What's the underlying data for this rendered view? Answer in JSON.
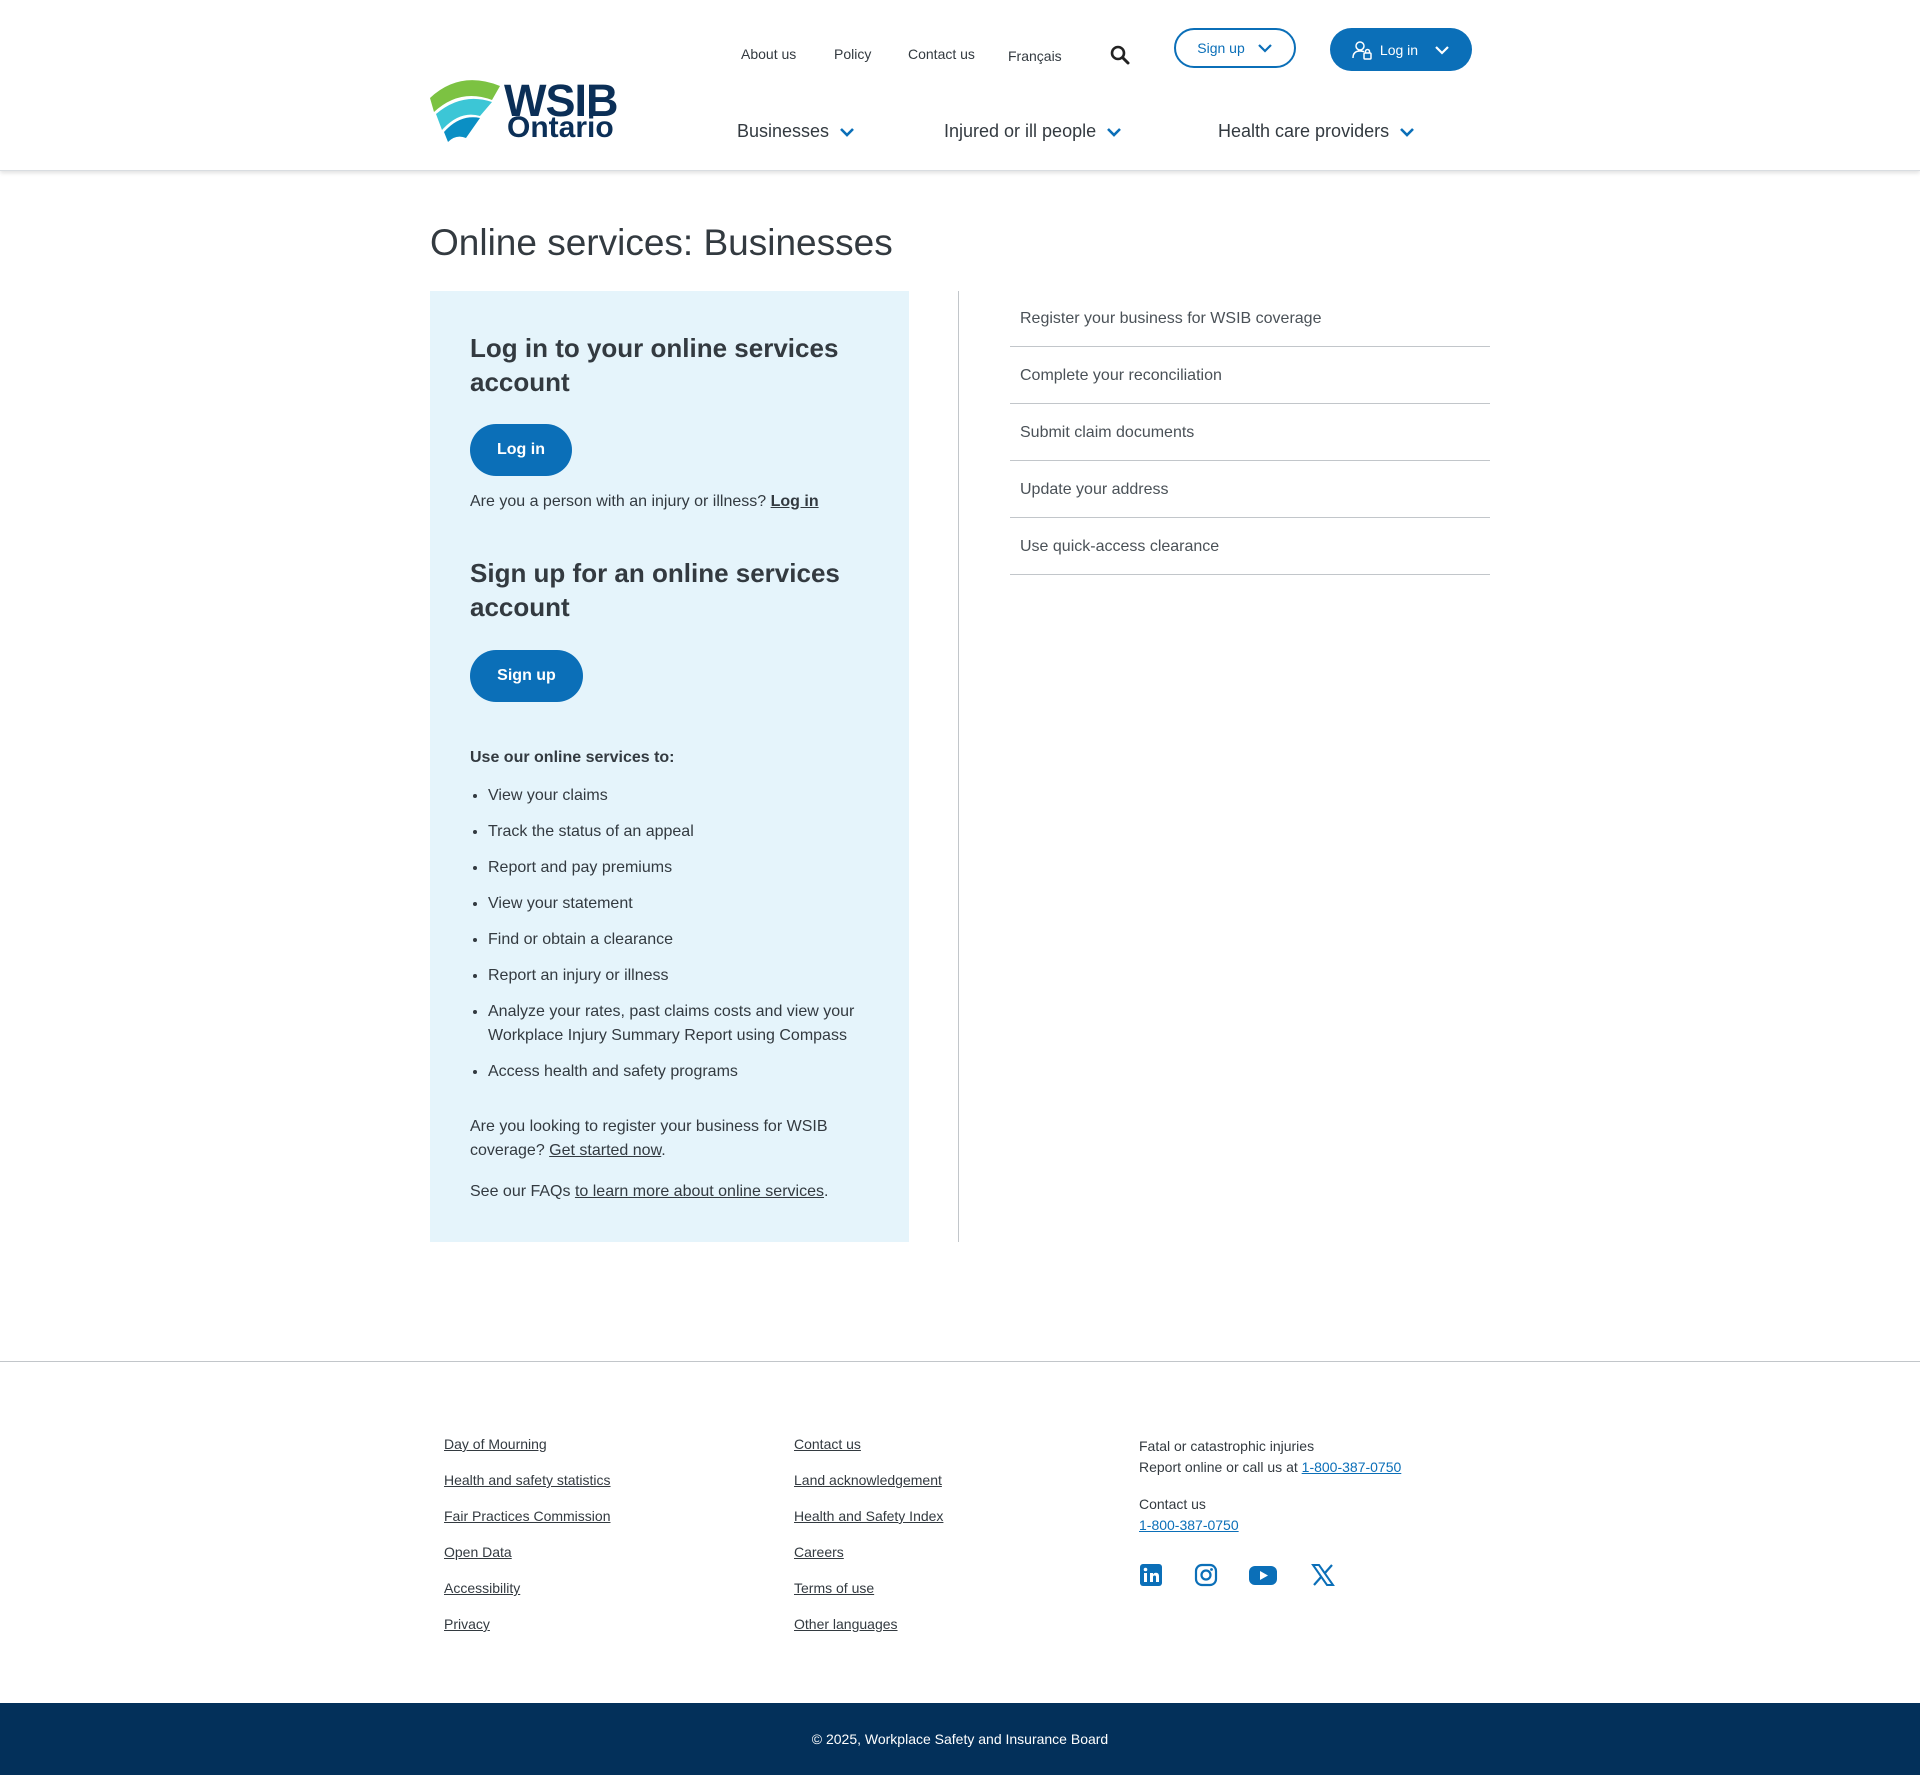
{
  "header": {
    "logo": {
      "line1": "WSIB",
      "line2": "Ontario"
    },
    "utility_nav": [
      "About us",
      "Policy",
      "Contact us",
      "Français"
    ],
    "signup_label": "Sign up",
    "login_label": "Log in",
    "main_nav": [
      "Businesses",
      "Injured or ill people",
      "Health care providers"
    ]
  },
  "main": {
    "page_title": "Online services: Businesses",
    "panel": {
      "login_heading": "Log in to your online services account",
      "login_button": "Log in",
      "injury_prompt": "Are you a person with an injury or illness?",
      "injury_link": "Log in",
      "signup_heading": "Sign up for an online services account",
      "signup_button": "Sign up",
      "services_intro": "Use our online services to:",
      "services": [
        "View your claims",
        "Track the status of an appeal",
        "Report and pay premiums",
        "View your statement",
        "Find or obtain a clearance",
        "Report an injury or illness",
        "Analyze your rates, past claims costs and view your Workplace Injury Summary Report using Compass",
        "Access health and safety programs"
      ],
      "register_text": "Are you looking to register your business for WSIB coverage?",
      "register_link": "Get started now",
      "faq_text": "See our FAQs",
      "faq_link": "to learn more about online services",
      "period": "."
    },
    "quick_links": [
      "Register your business for WSIB coverage",
      "Complete your reconciliation",
      "Submit claim documents",
      "Update your address",
      "Use quick-access clearance"
    ]
  },
  "footer": {
    "col1": [
      "Day of Mourning",
      "Health and safety statistics",
      "Fair Practices Commission",
      "Open Data",
      "Accessibility",
      "Privacy"
    ],
    "col2": [
      "Contact us",
      "Land acknowledgement",
      "Health and Safety Index",
      "Careers",
      "Terms of use",
      "Other languages"
    ],
    "fatal_title": "Fatal or catastrophic injuries",
    "fatal_text": "Report online or call us at",
    "fatal_phone": "1-800-387-0750",
    "contact_title": "Contact us",
    "contact_phone": "1-800-387-0750",
    "social_icons": [
      "linkedin-icon",
      "instagram-icon",
      "youtube-icon",
      "x-icon"
    ],
    "copyright": "© 2025, Workplace Safety and Insurance Board"
  },
  "colors": {
    "primary": "#0b6fb8",
    "navy": "#03305a",
    "panel_bg": "#e5f4fb",
    "logo_green": "#7cc242",
    "logo_teal": "#3cc6d6"
  }
}
